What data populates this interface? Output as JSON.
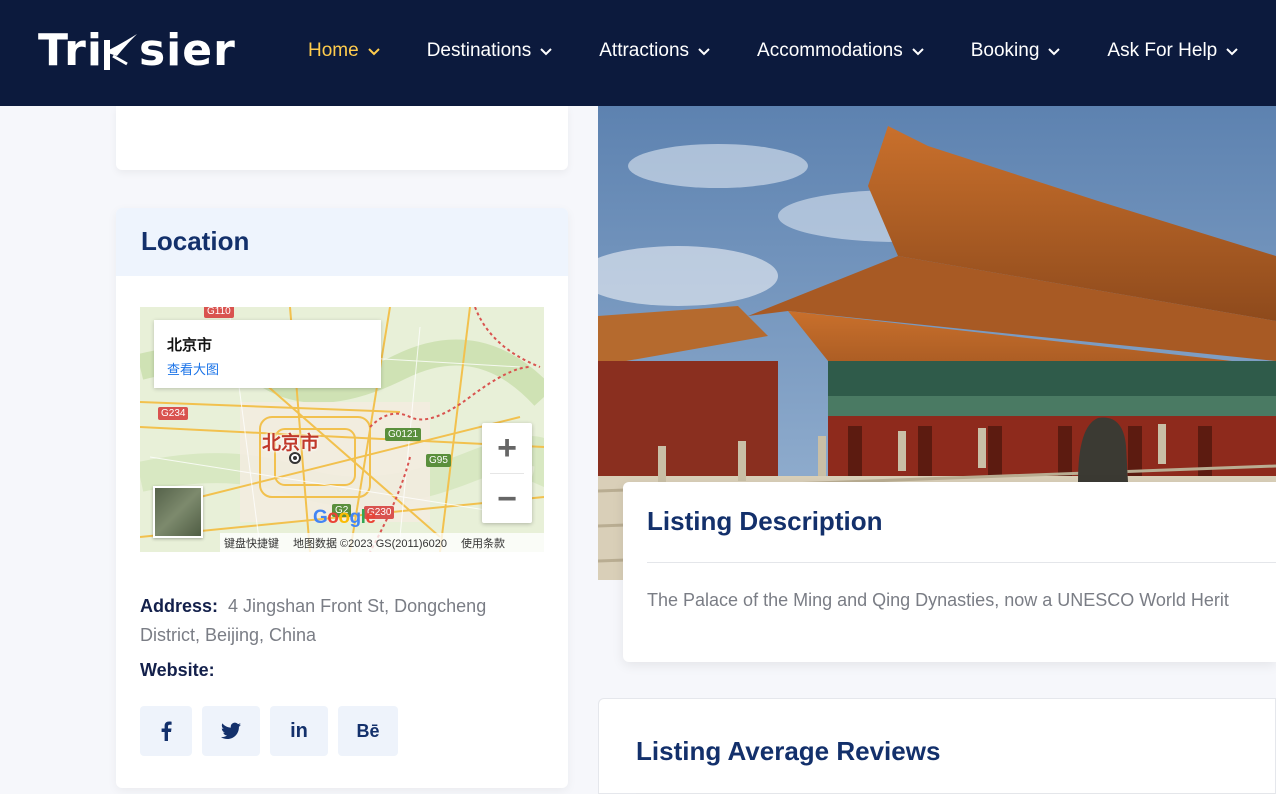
{
  "brand": {
    "name_left": "Tri",
    "name_right": "sier"
  },
  "nav": [
    {
      "label": "Home",
      "active": true
    },
    {
      "label": "Destinations"
    },
    {
      "label": "Attractions"
    },
    {
      "label": "Accommodations"
    },
    {
      "label": "Booking"
    },
    {
      "label": "Ask For Help"
    }
  ],
  "location": {
    "title": "Location",
    "map": {
      "popup_city": "北京市",
      "popup_link": "查看大图",
      "city_label": "北京市",
      "road_labels": [
        "G110",
        "G234",
        "G0121",
        "G95",
        "G2",
        "G230"
      ],
      "google": "Google",
      "footer_shortcuts": "键盘快捷键",
      "footer_data": "地图数据 ©2023 GS(2011)6020",
      "footer_terms": "使用条款",
      "zoom_in": "+",
      "zoom_out": "−"
    },
    "address_label": "Address:",
    "address_value": "4 Jingshan Front St, Dongcheng District, Beijing, China",
    "website_label": "Website:",
    "socials": [
      {
        "name": "facebook",
        "glyph": "f"
      },
      {
        "name": "twitter",
        "glyph": "🐦"
      },
      {
        "name": "linkedin",
        "glyph": "in"
      },
      {
        "name": "behance",
        "glyph": "Bē"
      }
    ]
  },
  "listing": {
    "description_title": "Listing Description",
    "description_text": "The Palace of the Ming and Qing Dynasties, now a UNESCO World Herit",
    "reviews_title": "Listing Average Reviews"
  },
  "colors": {
    "header_bg": "#0c1a3d",
    "accent": "#ffcc4d",
    "heading": "#13306b"
  }
}
